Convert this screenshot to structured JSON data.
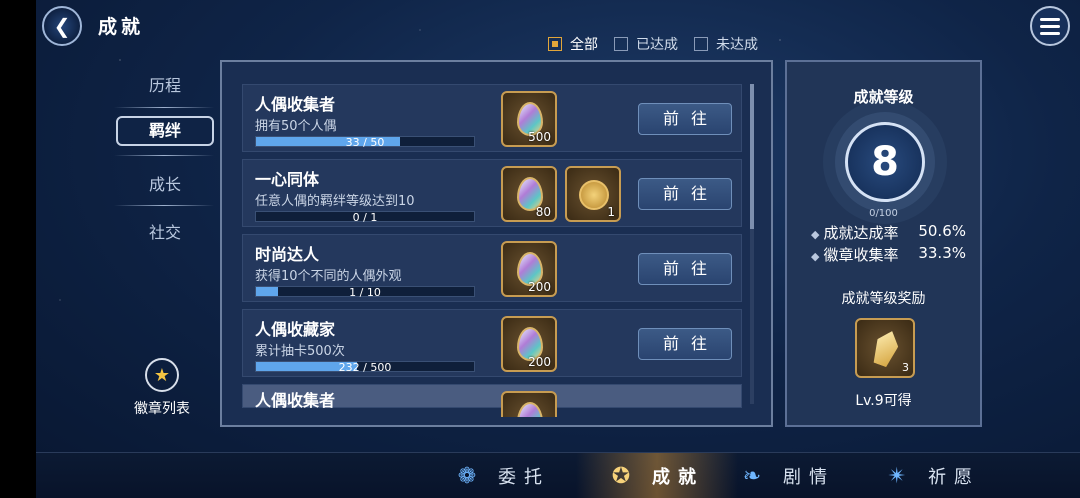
{
  "header": {
    "title": "成就"
  },
  "filters": [
    {
      "label": "全部",
      "checked": true
    },
    {
      "label": "已达成",
      "checked": false
    },
    {
      "label": "未达成",
      "checked": false
    }
  ],
  "nav": {
    "items": [
      "历程",
      "羁绊",
      "成长",
      "社交"
    ],
    "active": "羁绊",
    "badge_list": "徽章列表"
  },
  "achievements": [
    {
      "title": "人偶收集者",
      "desc": "拥有50个人偶",
      "progress_text": "33 / 50",
      "progress": 0.66,
      "rewards": [
        {
          "icon": "gem-icon",
          "qty": "500"
        }
      ],
      "button": "前往"
    },
    {
      "title": "一心同体",
      "desc": "任意人偶的羁绊等级达到10",
      "progress_text": "0 / 1",
      "progress": 0.0,
      "rewards": [
        {
          "icon": "gem-icon",
          "qty": "80"
        },
        {
          "icon": "coin-icon",
          "qty": "1"
        }
      ],
      "button": "前往"
    },
    {
      "title": "时尚达人",
      "desc": "获得10个不同的人偶外观",
      "progress_text": "1 / 10",
      "progress": 0.1,
      "rewards": [
        {
          "icon": "gem-icon",
          "qty": "200"
        }
      ],
      "button": "前往"
    },
    {
      "title": "人偶收藏家",
      "desc": "累计抽卡500次",
      "progress_text": "232 / 500",
      "progress": 0.464,
      "rewards": [
        {
          "icon": "gem-icon",
          "qty": "200"
        }
      ],
      "button": "前往"
    },
    {
      "title": "人偶收集者"
    }
  ],
  "level_panel": {
    "title": "成就等级",
    "level": "8",
    "exp_text": "0/100",
    "stats": [
      {
        "label": "成就达成率",
        "value": "50.6%"
      },
      {
        "label": "徽章收集率",
        "value": "33.3%"
      }
    ],
    "reward_title": "成就等级奖励",
    "reward_qty": "3",
    "reward_condition": "Lv.9可得"
  },
  "bottom_tabs": [
    {
      "label": "委托",
      "icon": "feather-icon",
      "active": false
    },
    {
      "label": "成就",
      "icon": "medal-icon",
      "active": true
    },
    {
      "label": "剧情",
      "icon": "wing-icon",
      "active": false
    },
    {
      "label": "祈愿",
      "icon": "star-icon",
      "active": false
    }
  ],
  "colors": {
    "accent": "#e2a63a",
    "progress": "#5fa6ec",
    "panel": "#1a2e52"
  }
}
